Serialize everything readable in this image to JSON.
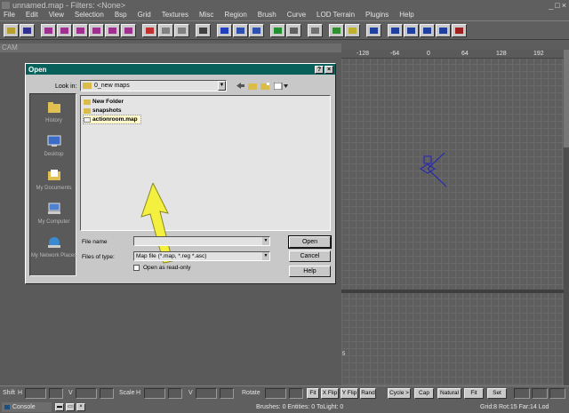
{
  "window": {
    "title": "unnamed.map - Filters: <None>",
    "minimize": "_",
    "maximize": "□",
    "close": "×"
  },
  "menu": [
    "File",
    "Edit",
    "View",
    "Selection",
    "Bsp",
    "Grid",
    "Textures",
    "Misc",
    "Region",
    "Brush",
    "Curve",
    "LOD Terrain",
    "Plugins",
    "Help"
  ],
  "camera": {
    "title": "CAM"
  },
  "grid": {
    "ruler": [
      "-128",
      "-64",
      "0",
      "64",
      "128",
      "192"
    ],
    "side_label": "5"
  },
  "dialog": {
    "title": "Open",
    "help_btn": "?",
    "close_btn": "×",
    "look_in_label": "Look in:",
    "look_in_value": "0_new maps",
    "places": [
      "History",
      "Desktop",
      "My Documents",
      "My Computer",
      "My Network Places"
    ],
    "files": [
      {
        "name": "New Folder",
        "type": "folder"
      },
      {
        "name": "snapshots",
        "type": "folder"
      },
      {
        "name": "actionroom.map",
        "type": "file",
        "selected": true
      }
    ],
    "file_name_label": "File name",
    "file_name_value": "",
    "file_type_label": "Files of type:",
    "file_type_value": "Map file (*.map, *.reg *.asc)",
    "read_only_label": "Open as read-only",
    "open_btn": "Open",
    "cancel_btn": "Cancel",
    "help_label": "Help"
  },
  "bottom": {
    "shift_label": "Shift",
    "h1": "H",
    "v1": "V",
    "scale_label": "Scale",
    "h2": "H",
    "v2": "V",
    "rotate_label": "Rotate",
    "fit": "Fit",
    "xflip": "X Flip",
    "yflip": "Y Flip",
    "rand": "Rand",
    "cycle": "Cycle >",
    "cap": "Cap",
    "natural": "Natural",
    "fit2": "Fit",
    "set": "Set"
  },
  "status": {
    "console": "Console",
    "counts": "Brushes: 0 Entities: 0 ToLight: 0",
    "grid": "Grid:8 Rot:15 Far:14 Lod"
  },
  "colors": {
    "dialog_title": "#08605a",
    "arrow": "#f4f040",
    "brush": "#2020c0"
  }
}
